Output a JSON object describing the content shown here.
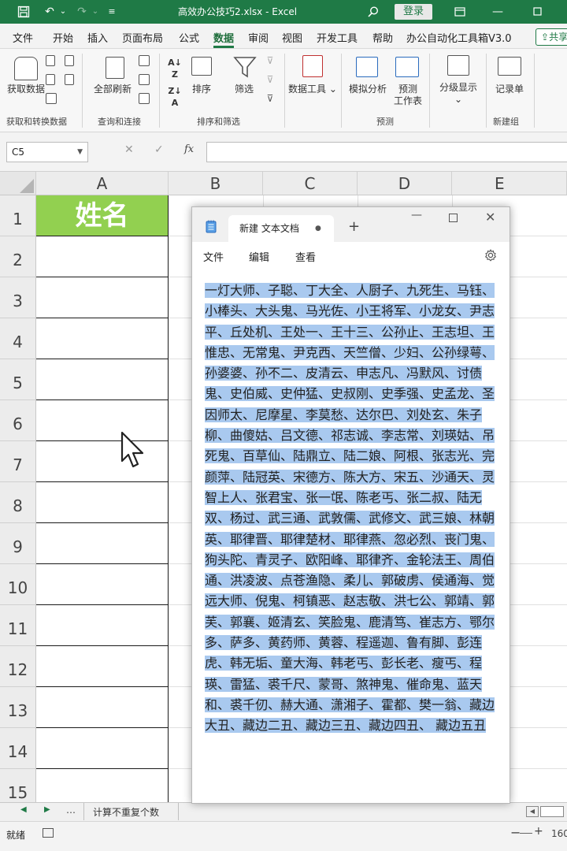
{
  "titlebar": {
    "filename": "高效办公技巧2.xlsx",
    "separator": "-",
    "app": "Excel",
    "login": "登录"
  },
  "menus": [
    "文件",
    "开始",
    "插入",
    "页面布局",
    "公式",
    "数据",
    "审阅",
    "视图",
    "开发工具",
    "帮助",
    "办公自动化工具箱V3.0"
  ],
  "active_menu": "数据",
  "share_label": "共享",
  "ribbon": {
    "get_data": "获取数据",
    "refresh_all": "全部刷新",
    "sort": "排序",
    "filter": "筛选",
    "data_tools": "数据工具",
    "what_if": "模拟分析",
    "forecast_sheet_1": "预测",
    "forecast_sheet_2": "工作表",
    "outline": "分级显示",
    "record_form": "记录单",
    "groups": [
      "获取和转换数据",
      "查询和连接",
      "排序和筛选",
      "预测",
      "新建组"
    ]
  },
  "formula_bar": {
    "name_box": "C5",
    "fx": "fx",
    "cancel": "✕",
    "enter": "✓"
  },
  "sheet": {
    "columns": [
      "A",
      "B",
      "C",
      "D",
      "E"
    ],
    "rows": [
      "1",
      "2",
      "3",
      "4",
      "5",
      "6",
      "7",
      "8",
      "9",
      "10",
      "11",
      "12",
      "13",
      "14",
      "15"
    ],
    "a1": "姓名",
    "tab_name": "计算不重复个数"
  },
  "status": {
    "ready": "就绪",
    "zoom": "160",
    "minus": "−",
    "plus": "+"
  },
  "notepad": {
    "tab_title": "新建 文本文档",
    "modified_dot": "●",
    "new_tab": "+",
    "menu_file": "文件",
    "menu_edit": "编辑",
    "menu_view": "查看",
    "text": "一灯大师、子聪、丁大全、人厨子、九死生、马钰、小棒头、大头鬼、马光佐、小王将军、小龙女、尹志平、丘处机、王处一、王十三、公孙止、王志坦、王惟忠、无常鬼、尹克西、天竺僧、少妇、公孙绿萼、孙婆婆、孙不二、皮清云、申志凡、冯默风、讨债鬼、史伯威、史仲猛、史叔刚、史季强、史孟龙、圣因师太、尼摩星、李莫愁、达尔巴、刘处玄、朱子柳、曲傻姑、吕文德、祁志诚、李志常、刘瑛姑、吊死鬼、百草仙、陆鼎立、陆二娘、阿根、张志光、完颜萍、陆冠英、宋德方、陈大方、宋五、沙通天、灵智上人、张君宝、张一氓、陈老丐、张二叔、陆无双、杨过、武三通、武敦儒、武修文、武三娘、林朝英、耶律晋、耶律楚材、耶律燕、忽必烈、丧门鬼、狗头陀、青灵子、欧阳峰、耶律齐、金轮法王、周伯通、洪凌波、点苍渔隐、柔儿、郭破虏、侯通海、觉远大师、倪鬼、柯镇恶、赵志敬、洪七公、郭靖、郭芙、郭襄、姬清玄、笑脸鬼、鹿清笃、崔志方、鄂尔多、萨多、黄药师、黄蓉、程遥迦、鲁有脚、彭连虎、韩无垢、童大海、韩老丐、彭长老、瘦丐、程瑛、雷猛、裘千尺、蒙哥、煞神鬼、催命鬼、蓝天和、裘千仞、赫大通、潇湘子、霍都、樊一翁、藏边大丑、藏边二丑、藏边三丑、藏边四丑、 藏边五丑"
  }
}
